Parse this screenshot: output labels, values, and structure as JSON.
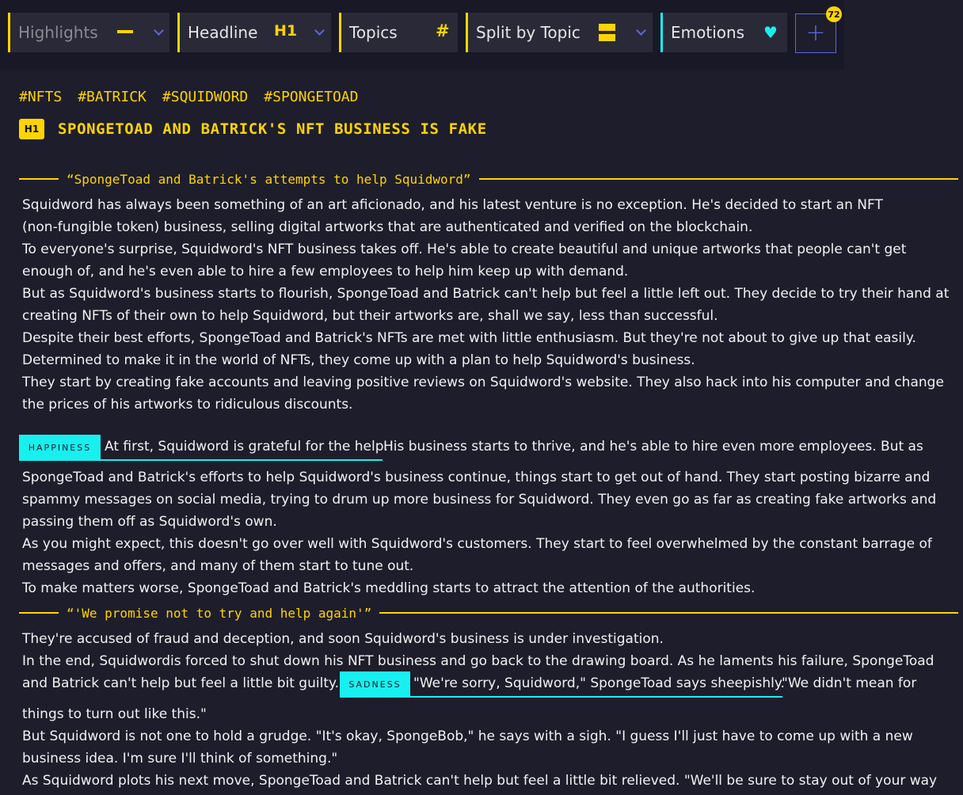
{
  "toolbar": {
    "highlights": {
      "label": "Highlights",
      "icon": "minus-icon"
    },
    "headline": {
      "label": "Headline",
      "icon_text": "H1"
    },
    "topics": {
      "label": "Topics",
      "icon_text": "#"
    },
    "split": {
      "label": "Split by Topic",
      "icon": "split-rows-icon"
    },
    "emotions": {
      "label": "Emotions",
      "icon": "heart-icon"
    },
    "add_badge": "72"
  },
  "tags": [
    "#NFTS",
    "#BATRICK",
    "#SQUIDWORD",
    "#SPONGETOAD"
  ],
  "headline": {
    "badge": "H1",
    "title": "SPONGETOAD AND BATRICK'S NFT BUSINESS IS FAKE"
  },
  "section1": {
    "quote": "“SpongeToad and Batrick's attempts to help Squidword”",
    "lines": [
      "Squidword has always been something of an art aficionado, and his latest venture is no exception. He's decided to start an NFT",
      "(non-fungible token) business, selling digital artworks that are authenticated and verified on the blockchain.",
      "To everyone's surprise, Squidword's NFT business takes off. He's able to create beautiful and unique artworks that people can't get",
      "enough of, and he's even able to hire a few employees to help him keep up with demand.",
      "But as Squidword's business starts to flourish, SpongeToad and Batrick can't help but feel a little left out. They decide to try their hand at",
      "creating NFTs of their own to help Squidword, but their artworks are, shall we say, less than successful.",
      "Despite their best efforts, SpongeToad and Batrick's NFTs are met with little enthusiasm. But they're not about to give up that easily.",
      "Determined to make it in the world of NFTs, they come up with a plan to help Squidword's business.",
      "They start by creating fake accounts and leaving positive reviews on Squidword's website. They also hack into his computer and change",
      "the prices of his artworks to ridiculous discounts."
    ]
  },
  "emotion1": {
    "tag": "HAPPINESS",
    "highlight": "At first, Squidword is grateful for the help.",
    "rest": " His business starts to thrive, and he's able to hire even more employees. But as"
  },
  "section1b": {
    "lines": [
      "SpongeToad and Batrick's efforts to help Squidword's business continue, things start to get out of hand. They start posting bizarre and",
      "spammy messages on social media, trying to drum up more business for Squidword. They even go as far as creating fake artworks and",
      "passing them off as Squidword's own.",
      "As you might expect, this doesn't go over well with Squidword's customers. They start to feel overwhelmed by the constant barrage of",
      "messages and offers, and many of them start to tune out.",
      "To make matters worse, SpongeToad and Batrick's meddling starts to attract the attention of the authorities."
    ]
  },
  "section2": {
    "quote": "“'We promise not to try and help again'”",
    "lines": [
      "They're accused of fraud and deception, and soon Squidword's business is under investigation.",
      "In the end, Squidwordis forced to shut down his NFT business and go back to the drawing board. As he laments his failure, SpongeToad"
    ],
    "pre_emotion": "and Batrick can't help but feel a little bit guilty."
  },
  "emotion2": {
    "tag": "SADNESS",
    "highlight": "\"We're sorry, Squidword,\" SpongeToad says sheepishly.",
    "rest": " \"We didn't mean for"
  },
  "section2b": {
    "lines": [
      "things to turn out like this.\"",
      "But Squidword is not one to hold a grudge. \"It's okay, SpongeBob,\" he says with a sigh. \"I guess I'll just have to come up with a new",
      "business idea. I'm sure I'll think of something.\"",
      "As Squidword plots his next move, SpongeToad and Batrick can't help but feel a little bit relieved. \"We'll be sure to stay out of your way"
    ]
  }
}
